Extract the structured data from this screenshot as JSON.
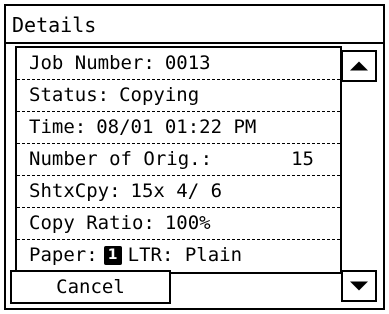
{
  "screen": {
    "title": "Details"
  },
  "details": {
    "rows": [
      {
        "label": "Job Number:",
        "value": "0013"
      },
      {
        "label": "Status:",
        "value": "Copying"
      },
      {
        "label": "Time:",
        "value": "08/01 01:22 PM"
      },
      {
        "label": "Number of Orig.:",
        "value": "15"
      },
      {
        "label": "ShtxCpy:",
        "value": "15x 4/ 6"
      },
      {
        "label": "Copy Ratio:",
        "value": "100%"
      },
      {
        "label": "Paper:",
        "badge": "1",
        "value": "LTR: Plain"
      }
    ]
  },
  "buttons": {
    "cancel_label": "Cancel",
    "scroll_up_icon": "triangle-up-icon",
    "scroll_down_icon": "triangle-down-icon"
  }
}
